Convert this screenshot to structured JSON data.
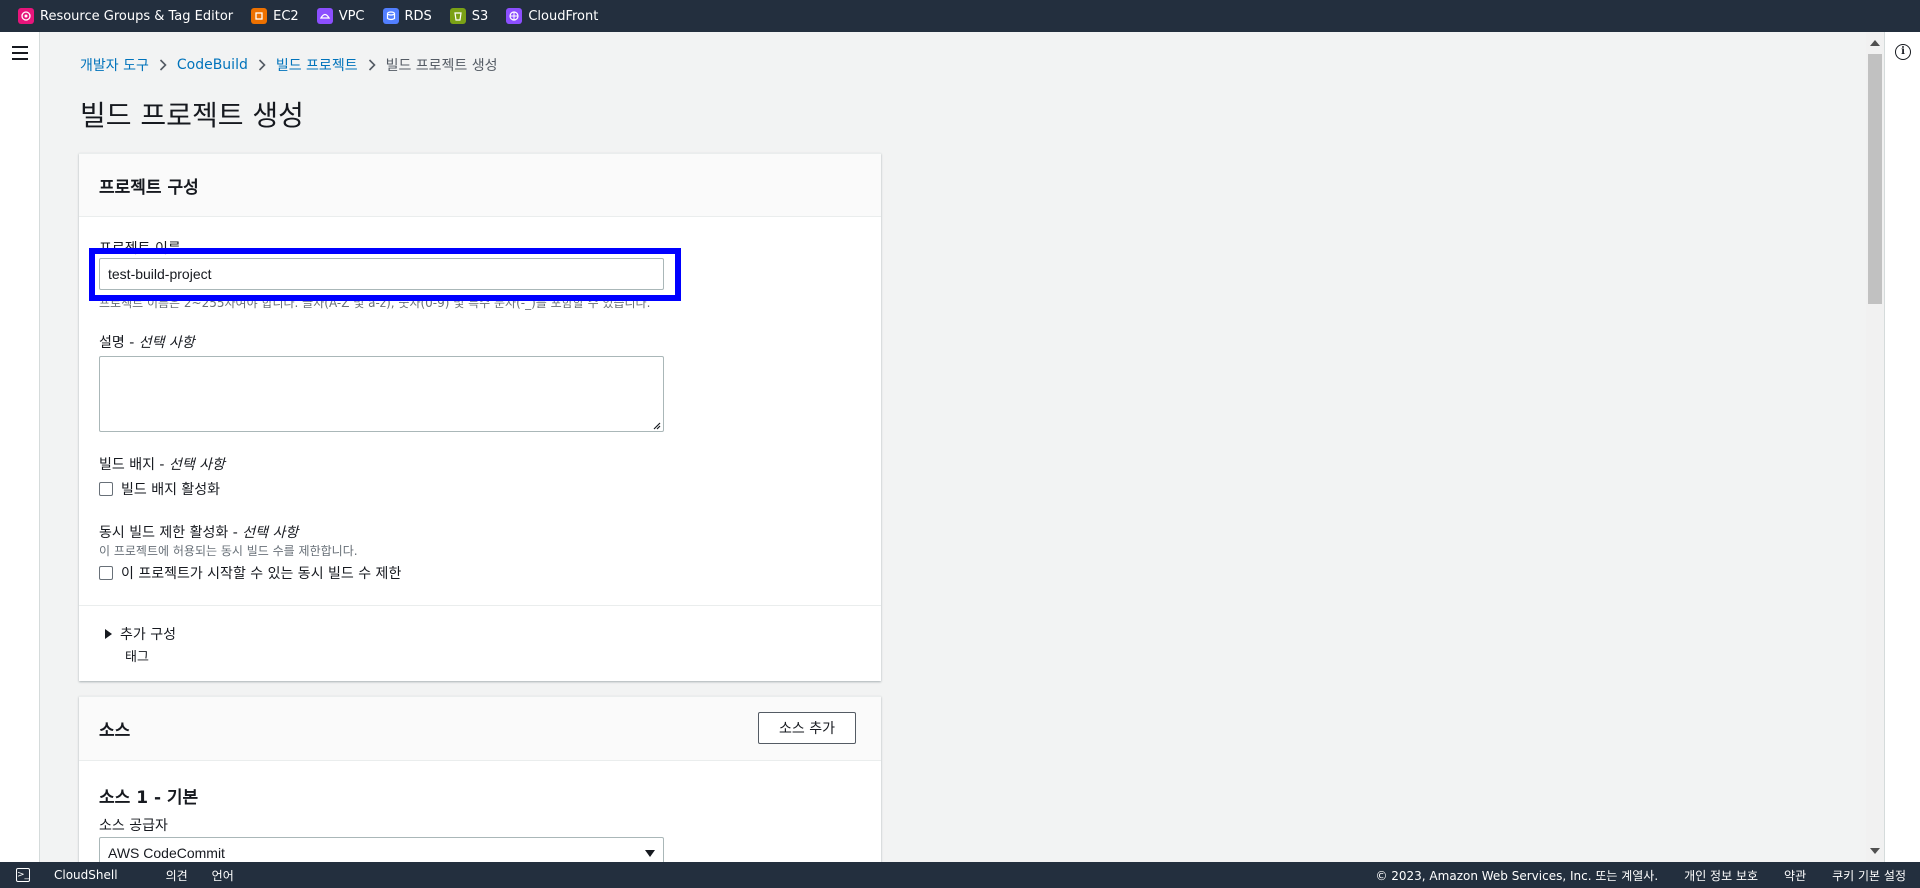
{
  "favorites": [
    {
      "label": "Resource Groups & Tag Editor",
      "icon": "resource-groups-icon",
      "color": "#e7157b"
    },
    {
      "label": "EC2",
      "icon": "ec2-icon",
      "color": "#ed7100"
    },
    {
      "label": "VPC",
      "icon": "vpc-icon",
      "color": "#8c4fff"
    },
    {
      "label": "RDS",
      "icon": "rds-icon",
      "color": "#527fff"
    },
    {
      "label": "S3",
      "icon": "s3-icon",
      "color": "#7aa116"
    },
    {
      "label": "CloudFront",
      "icon": "cloudfront-icon",
      "color": "#8c4fff"
    }
  ],
  "breadcrumb": {
    "items": [
      "개발자 도구",
      "CodeBuild",
      "빌드 프로젝트"
    ],
    "current": "빌드 프로젝트 생성"
  },
  "page_title": "빌드 프로젝트 생성",
  "project_config": {
    "title": "프로젝트 구성",
    "name_label": "프로젝트 이름",
    "name_value": "test-build-project",
    "name_hint": "프로젝트 이름은 2~255자여야 합니다. 글자(A-Z 및 a-z), 숫자(0-9) 및 특수 문자(-_)를 포함할 수 있습니다.",
    "description_label": "설명",
    "description_optional": "선택 사항",
    "badge_label": "빌드 배지",
    "badge_optional": "선택 사항",
    "badge_checkbox": "빌드 배지 활성화",
    "concurrent_label": "동시 빌드 제한 활성화",
    "concurrent_optional": "선택 사항",
    "concurrent_hint": "이 프로젝트에 허용되는 동시 빌드 수를 제한합니다.",
    "concurrent_checkbox": "이 프로젝트가 시작할 수 있는 동시 빌드 수 제한",
    "additional_label": "추가 구성",
    "additional_sub": "태그"
  },
  "source": {
    "title": "소스",
    "add_button": "소스 추가",
    "source1_title": "소스 1 - 기본",
    "provider_label": "소스 공급자",
    "provider_value": "AWS CodeCommit"
  },
  "footer": {
    "cloudshell": "CloudShell",
    "feedback": "의견",
    "language": "언어",
    "copyright": "© 2023, Amazon Web Services, Inc. 또는 계열사.",
    "privacy": "개인 정보 보호",
    "terms": "약관",
    "cookies": "쿠키 기본 설정"
  }
}
